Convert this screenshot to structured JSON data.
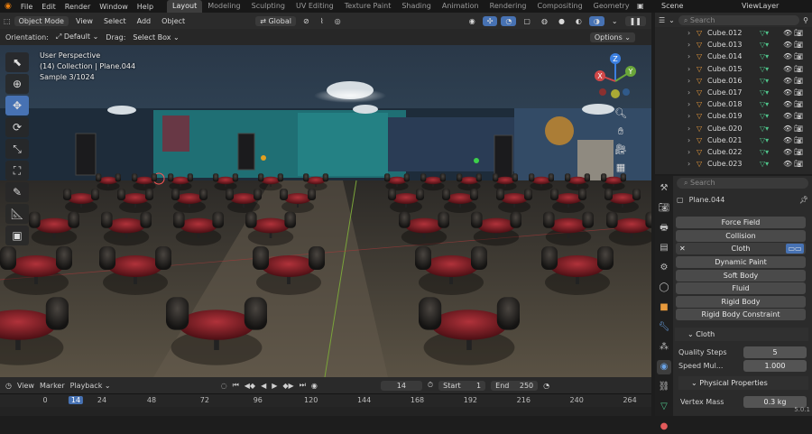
{
  "menu": {
    "items": [
      "File",
      "Edit",
      "Render",
      "Window",
      "Help"
    ]
  },
  "workspaces": {
    "tabs": [
      "Layout",
      "Modeling",
      "Sculpting",
      "UV Editing",
      "Texture Paint",
      "Shading",
      "Animation",
      "Rendering",
      "Compositing",
      "Geometry Node"
    ],
    "active": "Layout"
  },
  "scene": {
    "label": "Scene",
    "view_layer": "ViewLayer"
  },
  "header": {
    "mode": "Object Mode",
    "view": "View",
    "select": "Select",
    "add": "Add",
    "object": "Object",
    "orientation_dropdown": "Global"
  },
  "tool": {
    "orientation_label": "Orientation:",
    "orientation_value": "Default",
    "drag_label": "Drag:",
    "drag_value": "Select Box",
    "options": "Options"
  },
  "overlay": {
    "line1": "User Perspective",
    "line2": "(14) Collection | Plane.044",
    "line3": "Sample 3/1024"
  },
  "gizmo": {
    "z": "Z",
    "y": "Y",
    "x": "X"
  },
  "timeline": {
    "menus": [
      "View",
      "Marker",
      "Playback"
    ],
    "current_frame": "14",
    "start_label": "Start",
    "start_value": "1",
    "end_label": "End",
    "end_value": "250",
    "ticks": [
      "0",
      "14",
      "24",
      "48",
      "72",
      "96",
      "120",
      "144",
      "168",
      "192",
      "216",
      "240",
      "264"
    ]
  },
  "outliner": {
    "search_placeholder": "Search",
    "items": [
      "Cube.012",
      "Cube.013",
      "Cube.014",
      "Cube.015",
      "Cube.016",
      "Cube.017",
      "Cube.018",
      "Cube.019",
      "Cube.020",
      "Cube.021",
      "Cube.022",
      "Cube.023"
    ]
  },
  "properties": {
    "search_placeholder": "Search",
    "object_name": "Plane.044",
    "buttons": [
      "Force Field",
      "Collision",
      "Cloth",
      "Dynamic Paint",
      "Soft Body",
      "Fluid",
      "Rigid Body",
      "Rigid Body Constraint"
    ],
    "cloth_panel": "Cloth",
    "quality_label": "Quality Steps",
    "quality_value": "5",
    "speed_label": "Speed Mul...",
    "speed_value": "1.000",
    "physical_panel": "Physical Properties",
    "vertex_mass_label": "Vertex Mass",
    "vertex_mass_value": "0.3 kg"
  },
  "status": {
    "version": "5.0.1"
  },
  "colors": {
    "accent": "#4772b3",
    "tealwall": "#1f7a7a",
    "chair_red": "#8a1d24"
  }
}
